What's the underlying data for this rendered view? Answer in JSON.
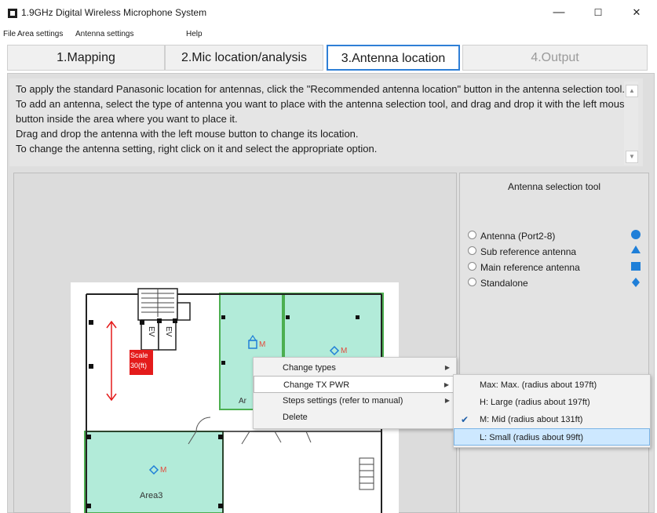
{
  "window": {
    "title": "1.9GHz Digital Wireless Microphone System",
    "minimize": "—",
    "maximize": "☐",
    "close": "✕"
  },
  "menubar": [
    "File",
    "Area settings",
    "Antenna settings",
    "Help"
  ],
  "tabs": [
    {
      "label": "1.Mapping"
    },
    {
      "label": "2.Mic location/analysis"
    },
    {
      "label": "3.Antenna location"
    },
    {
      "label": "4.Output"
    }
  ],
  "instructions": [
    "To apply the standard Panasonic location for antennas, click the \"Recommended antenna location\" button in the antenna selection tool.",
    "To add an antenna, select the type of antenna you want to place with the antenna selection tool, and drag and drop it with the left mouse button inside the area where you want to place it.",
    "Drag and drop the antenna with the left mouse button to change its location.",
    "To change the antenna setting, right click on it and select the appropriate option."
  ],
  "floorplan": {
    "ev": [
      "EV",
      "EV"
    ],
    "scale": [
      "Scale",
      "30(ft)"
    ],
    "mark": "M",
    "area_partial": "Ar",
    "area3": "Area3"
  },
  "tool": {
    "title": "Antenna selection tool",
    "options": [
      "Antenna (Port2-8)",
      "Sub reference antenna",
      "Main reference antenna",
      "Standalone"
    ]
  },
  "context_menu": [
    "Change types",
    "Change TX PWR",
    "Steps settings (refer to manual)",
    "Delete"
  ],
  "submenu": [
    "Max: Max. (radius about 197ft)",
    "H: Large (radius about 197ft)",
    "M: Mid (radius about 131ft)",
    "L: Small (radius about 99ft)"
  ],
  "submenu_checked": "M: Mid (radius about 131ft)",
  "colors": {
    "accent": "#2f7fd6",
    "area_fill": "#b2ebd9",
    "area_stroke": "#4caf50",
    "scale_red": "#e41b1b",
    "icon_blue": "#1f7fd8"
  }
}
